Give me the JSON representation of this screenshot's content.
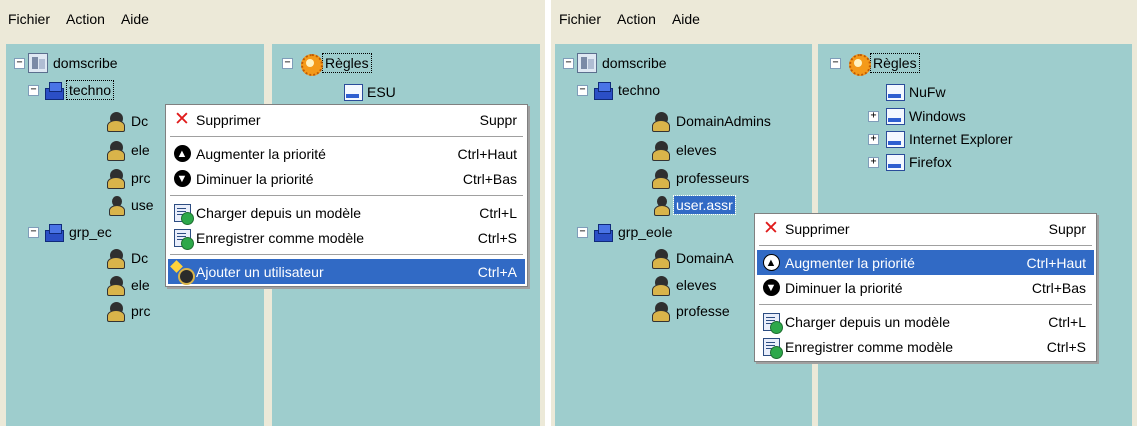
{
  "menu": [
    "Fichier",
    "Action",
    "Aide"
  ],
  "left": {
    "tree_a": {
      "root": "domscribe",
      "group1": "techno",
      "group1_children": [
        "Dc",
        "ele",
        "prc",
        "use"
      ],
      "group2": "grp_ec",
      "group2_children": [
        "Dc",
        "ele",
        "prc"
      ]
    },
    "tree_b": {
      "root": "Règles",
      "children": [
        "ESU"
      ]
    },
    "context_menu": {
      "items": [
        {
          "icon": "delete-icon",
          "label": "Supprimer",
          "shortcut": "Suppr"
        },
        {
          "icon": "arrow-up-icon",
          "label": "Augmenter la priorité",
          "shortcut": "Ctrl+Haut"
        },
        {
          "icon": "arrow-down-icon",
          "label": "Diminuer la priorité",
          "shortcut": "Ctrl+Bas"
        },
        {
          "icon": "load-template-icon",
          "label": "Charger depuis un modèle",
          "shortcut": "Ctrl+L"
        },
        {
          "icon": "save-template-icon",
          "label": "Enregistrer comme modèle",
          "shortcut": "Ctrl+S"
        },
        {
          "icon": "add-user-icon",
          "label": "Ajouter un utilisateur",
          "shortcut": "Ctrl+A"
        }
      ],
      "highlighted": "Ajouter un utilisateur"
    }
  },
  "right": {
    "tree_a": {
      "root": "domscribe",
      "group1": "techno",
      "group1_children": [
        "DomainAdmins",
        "eleves",
        "professeurs",
        "user.assr"
      ],
      "group2": "grp_eole",
      "group2_children": [
        "DomainA",
        "eleves",
        "professe"
      ]
    },
    "tree_b": {
      "root": "Règles",
      "children": [
        "NuFw",
        "Windows",
        "Internet Explorer",
        "Firefox"
      ]
    },
    "context_menu": {
      "items": [
        {
          "icon": "delete-icon",
          "label": "Supprimer",
          "shortcut": "Suppr"
        },
        {
          "icon": "arrow-up-icon",
          "label": "Augmenter la priorité",
          "shortcut": "Ctrl+Haut"
        },
        {
          "icon": "arrow-down-icon",
          "label": "Diminuer la priorité",
          "shortcut": "Ctrl+Bas"
        },
        {
          "icon": "load-template-icon",
          "label": "Charger depuis un modèle",
          "shortcut": "Ctrl+L"
        },
        {
          "icon": "save-template-icon",
          "label": "Enregistrer comme modèle",
          "shortcut": "Ctrl+S"
        }
      ],
      "highlighted": "Augmenter la priorité"
    }
  },
  "colors": {
    "pane_bg": "#9ecdcd",
    "window_bg": "#ece9d8",
    "selection": "#316ac5"
  }
}
